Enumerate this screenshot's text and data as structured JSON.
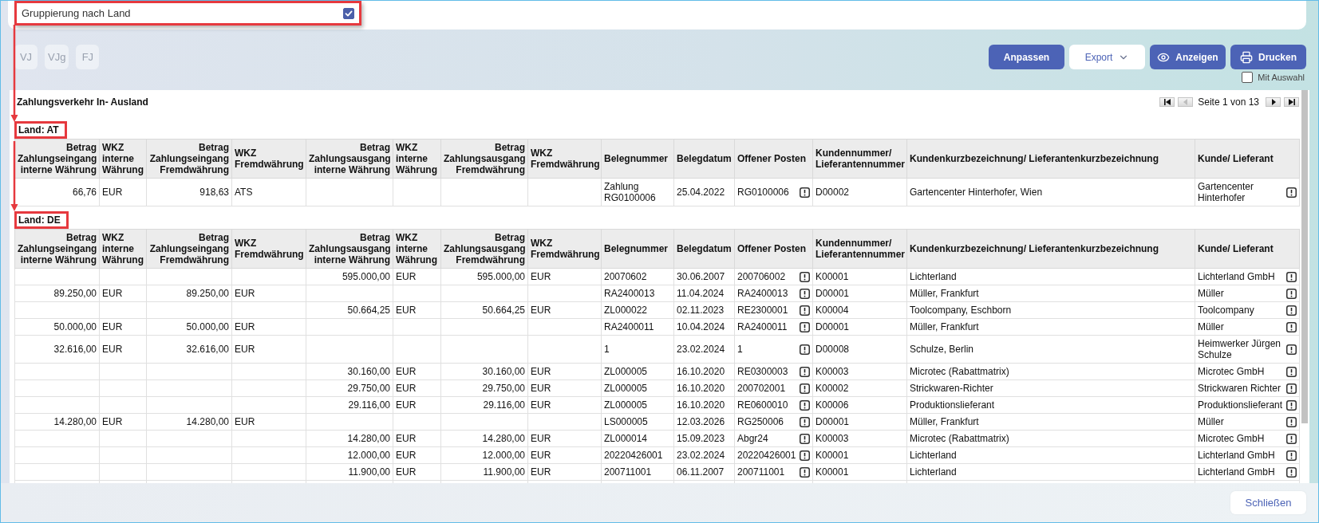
{
  "filter_option": {
    "label": "Gruppierung nach Land",
    "checked": true,
    "highlighted": true
  },
  "period_buttons": [
    {
      "label": "VJ",
      "disabled": true
    },
    {
      "label": "VJg",
      "disabled": true
    },
    {
      "label": "FJ",
      "disabled": true
    }
  ],
  "action_buttons": [
    {
      "label": "Anpassen",
      "kind": "primary"
    },
    {
      "label": "Export",
      "kind": "dropdown"
    },
    {
      "label": "Anzeigen",
      "kind": "view"
    },
    {
      "label": "Drucken",
      "kind": "print"
    }
  ],
  "selection_option": {
    "label": "Mit Auswahl",
    "checked": false
  },
  "report": {
    "title": "Zahlungsverkehr In- Ausland",
    "pagination": {
      "text": "Seite 1 von 13",
      "buttons": [
        {
          "kind": "first",
          "disabled": false
        },
        {
          "kind": "previous",
          "disabled": true
        },
        {
          "kind": "next",
          "disabled": false
        },
        {
          "kind": "last",
          "disabled": false
        }
      ]
    },
    "groups": [
      {
        "label": "Land: AT",
        "highlighted": true,
        "columns": [
          {
            "label": "Betrag Zahlungseingang interne Währung",
            "kind": "amount"
          },
          {
            "label": "WKZ interne Währung",
            "kind": "text"
          },
          {
            "label": "Betrag Zahlungseingang Fremdwährung",
            "kind": "amount"
          },
          {
            "label": "WKZ Fremdwährung",
            "kind": "text"
          },
          {
            "label": "Betrag Zahlungsausgang interne Währung",
            "kind": "amount"
          },
          {
            "label": "WKZ interne Währung",
            "kind": "text"
          },
          {
            "label": "Betrag Zahlungsausgang Fremdwährung",
            "kind": "amount"
          },
          {
            "label": "WKZ Fremdwährung",
            "kind": "text"
          },
          {
            "label": "Belegnummer",
            "kind": "text"
          },
          {
            "label": "Belegdatum",
            "kind": "text"
          },
          {
            "label": "Offener Posten",
            "kind": "detail"
          },
          {
            "label": "Kundennummer/ Lieferantennummer",
            "kind": "text"
          },
          {
            "label": "Kundenkurzbezeichnung/ Lieferantenkurzbezeichnung",
            "kind": "text"
          },
          {
            "label": "Kunde/ Lieferant",
            "kind": "detail"
          }
        ],
        "rows": [
          [
            "66,76",
            "EUR",
            "918,63",
            "ATS",
            null,
            null,
            null,
            null,
            "Zahlung RG0100006",
            "25.04.2022",
            "RG0100006",
            "D00002",
            "Gartencenter Hinterhofer, Wien",
            "Gartencenter Hinterhofer"
          ]
        ]
      },
      {
        "label": "Land: DE",
        "highlighted": true,
        "columns": [
          {
            "label": "Betrag Zahlungseingang interne Währung",
            "kind": "amount"
          },
          {
            "label": "WKZ interne Währung",
            "kind": "text"
          },
          {
            "label": "Betrag Zahlungseingang Fremdwährung",
            "kind": "amount"
          },
          {
            "label": "WKZ Fremdwährung",
            "kind": "text"
          },
          {
            "label": "Betrag Zahlungsausgang interne Währung",
            "kind": "amount"
          },
          {
            "label": "WKZ interne Währung",
            "kind": "text"
          },
          {
            "label": "Betrag Zahlungsausgang Fremdwährung",
            "kind": "amount"
          },
          {
            "label": "WKZ Fremdwährung",
            "kind": "text"
          },
          {
            "label": "Belegnummer",
            "kind": "text"
          },
          {
            "label": "Belegdatum",
            "kind": "text"
          },
          {
            "label": "Offener Posten",
            "kind": "detail"
          },
          {
            "label": "Kundennummer/ Lieferantennummer",
            "kind": "text"
          },
          {
            "label": "Kundenkurzbezeichnung/ Lieferantenkurzbezeichnung",
            "kind": "text"
          },
          {
            "label": "Kunde/ Lieferant",
            "kind": "detail"
          }
        ],
        "rows": [
          [
            null,
            null,
            null,
            null,
            "595.000,00",
            "EUR",
            "595.000,00",
            "EUR",
            "20070602",
            "30.06.2007",
            "200706002",
            "K00001",
            "Lichterland",
            "Lichterland GmbH"
          ],
          [
            "89.250,00",
            "EUR",
            "89.250,00",
            "EUR",
            null,
            null,
            null,
            null,
            "RA2400013",
            "11.04.2024",
            "RA2400013",
            "D00001",
            "Müller, Frankfurt",
            "Müller"
          ],
          [
            null,
            null,
            null,
            null,
            "50.664,25",
            "EUR",
            "50.664,25",
            "EUR",
            "ZL000022",
            "02.11.2023",
            "RE2300001",
            "K00004",
            "Toolcompany, Eschborn",
            "Toolcompany"
          ],
          [
            "50.000,00",
            "EUR",
            "50.000,00",
            "EUR",
            null,
            null,
            null,
            null,
            "RA2400011",
            "10.04.2024",
            "RA2400011",
            "D00001",
            "Müller, Frankfurt",
            "Müller"
          ],
          [
            "32.616,00",
            "EUR",
            "32.616,00",
            "EUR",
            null,
            null,
            null,
            null,
            "1",
            "23.02.2024",
            "1",
            "D00008",
            "Schulze, Berlin",
            "Heimwerker Jürgen Schulze"
          ],
          [
            null,
            null,
            null,
            null,
            "30.160,00",
            "EUR",
            "30.160,00",
            "EUR",
            "ZL000005",
            "16.10.2020",
            "RE0300003",
            "K00003",
            "Microtec (Rabattmatrix)",
            "Microtec GmbH"
          ],
          [
            null,
            null,
            null,
            null,
            "29.750,00",
            "EUR",
            "29.750,00",
            "EUR",
            "ZL000005",
            "16.10.2020",
            "200702001",
            "K00002",
            "Strickwaren-Richter",
            "Strickwaren Richter"
          ],
          [
            null,
            null,
            null,
            null,
            "29.116,00",
            "EUR",
            "29.116,00",
            "EUR",
            "ZL000005",
            "16.10.2020",
            "RE0600010",
            "K00006",
            "Produktionslieferant",
            "Produktionslieferant"
          ],
          [
            "14.280,00",
            "EUR",
            "14.280,00",
            "EUR",
            null,
            null,
            null,
            null,
            "LS000005",
            "12.03.2026",
            "RG250006",
            "D00001",
            "Müller, Frankfurt",
            "Müller"
          ],
          [
            null,
            null,
            null,
            null,
            "14.280,00",
            "EUR",
            "14.280,00",
            "EUR",
            "ZL000014",
            "15.09.2023",
            "Abgr24",
            "K00003",
            "Microtec (Rabattmatrix)",
            "Microtec GmbH"
          ],
          [
            null,
            null,
            null,
            null,
            "12.000,00",
            "EUR",
            "12.000,00",
            "EUR",
            "20220426001",
            "23.02.2024",
            "20220426001",
            "K00001",
            "Lichterland",
            "Lichterland GmbH"
          ],
          [
            null,
            null,
            null,
            null,
            "11.900,00",
            "EUR",
            "11.900,00",
            "EUR",
            "200711001",
            "06.11.2007",
            "200711001",
            "K00001",
            "Lichterland",
            "Lichterland GmbH"
          ]
        ]
      }
    ]
  },
  "close_button": {
    "label": "Schließen"
  }
}
